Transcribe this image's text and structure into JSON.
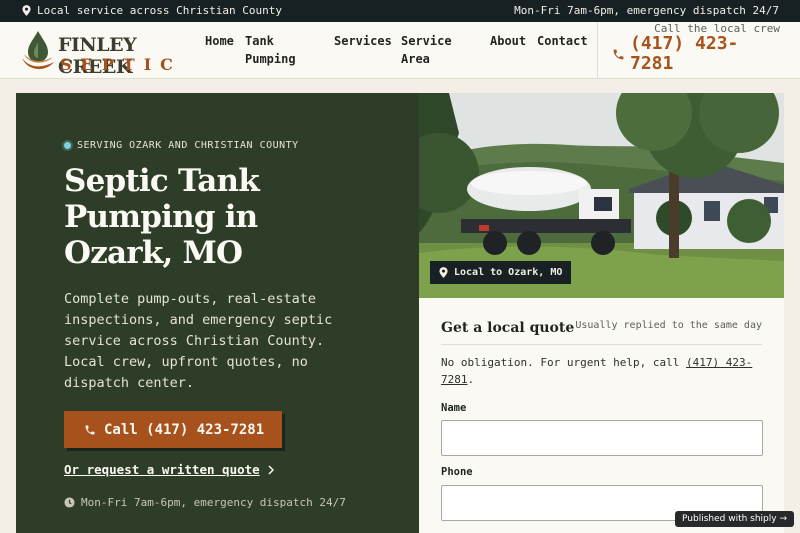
{
  "topbar": {
    "left_text": "Local service across Christian County",
    "right_text": "Mon-Fri 7am-6pm, emergency dispatch 24/7"
  },
  "header": {
    "logo": {
      "word1": "FINLEY CREEK",
      "word2": "SEPTIC"
    },
    "nav": [
      {
        "label": "Home"
      },
      {
        "label": "Tank Pumping"
      },
      {
        "label": "Services"
      },
      {
        "label": "Service Area"
      },
      {
        "label": "About"
      },
      {
        "label": "Contact"
      }
    ],
    "call_label": "Call the local crew",
    "phone": "(417) 423-7281"
  },
  "hero": {
    "eyebrow": "SERVING OZARK AND CHRISTIAN COUNTY",
    "title": "Septic Tank Pumping in Ozark, MO",
    "lead": "Complete pump-outs, real-estate inspections, and emergency septic service across Christian County. Local crew, upfront quotes, no dispatch center.",
    "cta_label": "Call (417) 423-7281",
    "quote_link": "Or request a written quote",
    "hours": "Mon-Fri 7am-6pm, emergency dispatch 24/7"
  },
  "photo": {
    "badge": "Local to Ozark, MO"
  },
  "form": {
    "title": "Get a local quote",
    "reply": "Usually replied to the same day",
    "note_prefix": "No obligation. For urgent help, call",
    "note_phone": "(417) 423-7281",
    "note_suffix": ".",
    "name_label": "Name",
    "phone_label": "Phone"
  },
  "footer": {
    "published": "Published with shiply →"
  },
  "colors": {
    "accent": "#a7521c",
    "hero_bg": "#2e3d27",
    "dark": "#172023",
    "paper": "#fbf9f4"
  }
}
